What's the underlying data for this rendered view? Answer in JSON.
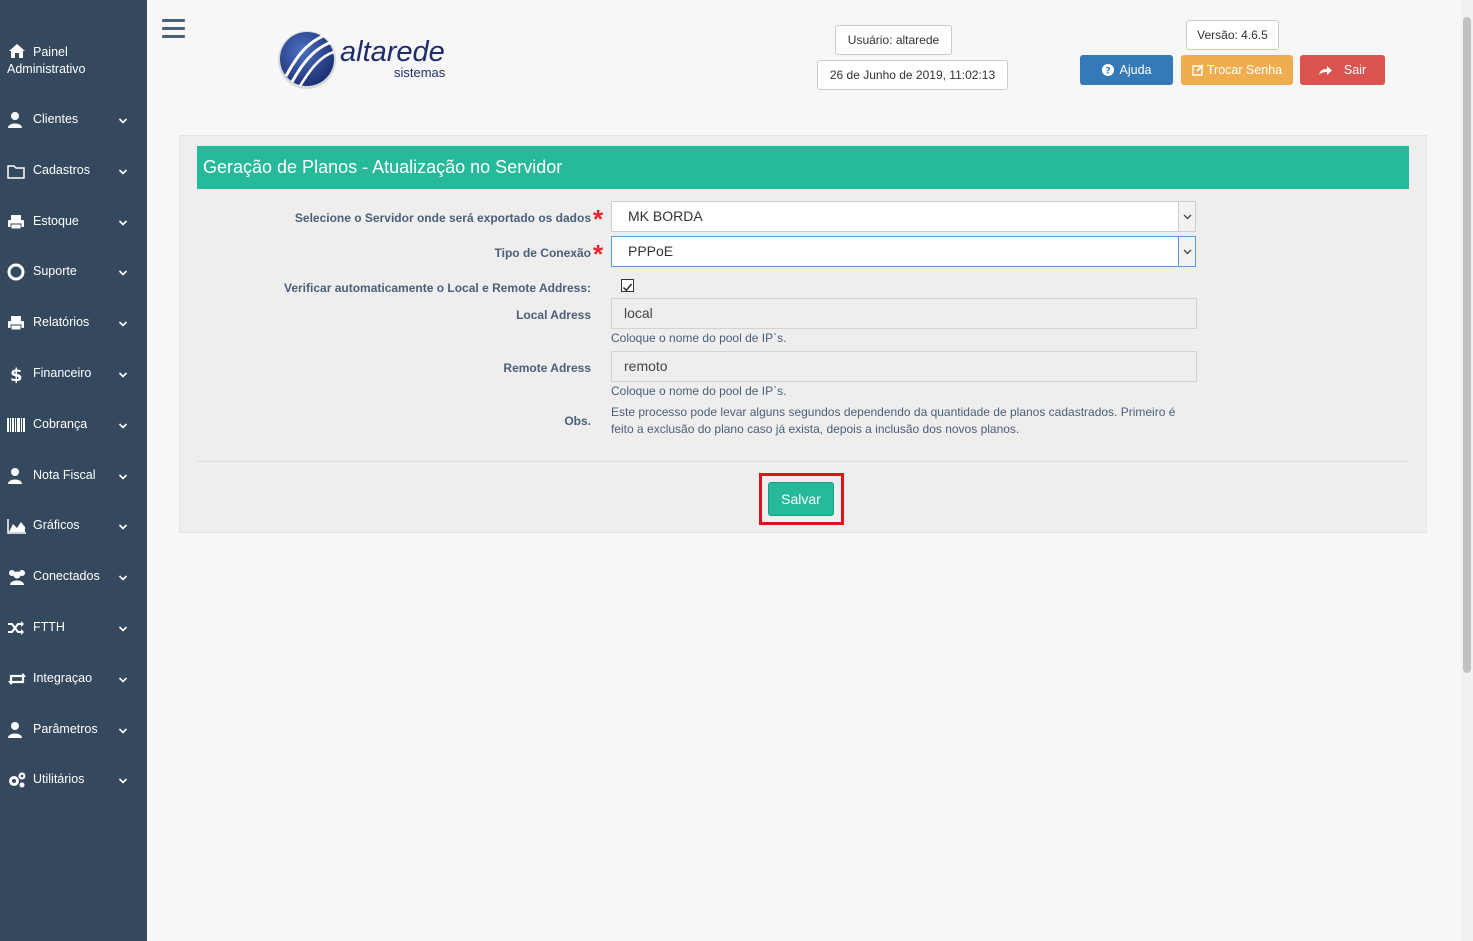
{
  "sidebar": {
    "home_label": "Painel Administrativo",
    "items": [
      {
        "label": "Clientes",
        "icon": "user-icon"
      },
      {
        "label": "Cadastros",
        "icon": "folder-icon"
      },
      {
        "label": "Estoque",
        "icon": "printer-icon"
      },
      {
        "label": "Suporte",
        "icon": "lifebuoy-icon"
      },
      {
        "label": "Relatórios",
        "icon": "printer-icon"
      },
      {
        "label": "Financeiro",
        "icon": "dollar-icon"
      },
      {
        "label": "Cobrança",
        "icon": "barcode-icon"
      },
      {
        "label": "Nota Fiscal",
        "icon": "user-icon"
      },
      {
        "label": "Gráficos",
        "icon": "area-chart-icon"
      },
      {
        "label": "Conectados",
        "icon": "users-icon"
      },
      {
        "label": "FTTH",
        "icon": "shuffle-icon"
      },
      {
        "label": "Integraçao",
        "icon": "retweet-icon"
      },
      {
        "label": "Parâmetros",
        "icon": "user-icon"
      },
      {
        "label": "Utilitários",
        "icon": "gears-icon"
      }
    ]
  },
  "header": {
    "logo_main": "altarede",
    "logo_sub": "sistemas",
    "user": "Usuário: altarede",
    "datetime": "26 de Junho de 2019, 11:02:13",
    "version": "Versão: 4.6.5",
    "help_label": "Ajuda",
    "change_password_label": "Trocar Senha",
    "logout_label": "Sair"
  },
  "form": {
    "title": "Geração de Planos - Atualização no Servidor",
    "server_label": "Selecione o Servidor onde será exportado os dados",
    "server_value": "MK BORDA",
    "connection_label": "Tipo de Conexão",
    "connection_value": "PPPoE",
    "auto_check_label": "Verificar automaticamente o Local e Remote Address:",
    "auto_check_checked": true,
    "local_label": "Local Adress",
    "local_value": "local",
    "local_hint": "Coloque o nome do pool de IP`s.",
    "remote_label": "Remote Adress",
    "remote_value": "remoto",
    "remote_hint": "Coloque o nome do pool de IP`s.",
    "obs_label": "Obs.",
    "obs_text": "Este processo pode levar alguns segundos dependendo da quantidade de planos cadastrados. Primeiro é feito a exclusão do plano caso já exista, depois a inclusão dos novos planos.",
    "save_label": "Salvar"
  },
  "colors": {
    "sidebar": "#34495e",
    "accent": "#26b99a",
    "help": "#337ab7",
    "warning": "#f0ad4e",
    "danger": "#d9534f",
    "highlight": "#e0131d"
  }
}
